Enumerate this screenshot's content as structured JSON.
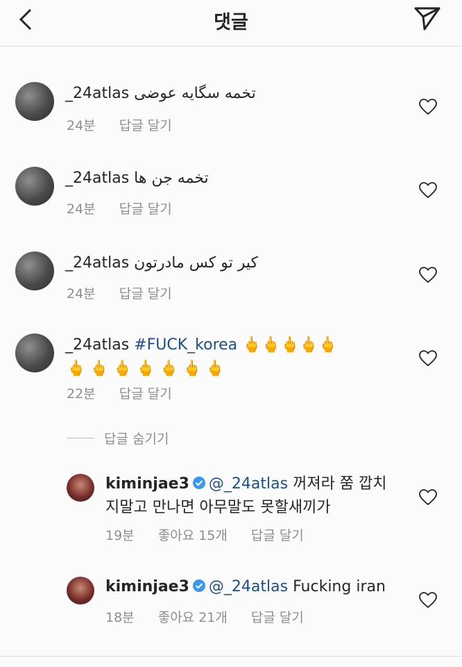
{
  "header": {
    "title": "댓글"
  },
  "comments": [
    {
      "username": "_24atlas",
      "text": "تخمه سگایه عوضی",
      "time": "24분",
      "reply": "답글 달기"
    },
    {
      "username": "_24atlas",
      "text": "تخمه جن ها",
      "time": "24분",
      "reply": "답글 달기"
    },
    {
      "username": "_24atlas",
      "text": "کیر تو کس مادرتون",
      "time": "24분",
      "reply": "답글 달기"
    },
    {
      "username": "_24atlas",
      "hashtag": "#FUCK_korea",
      "emoji_line1": "🖕🖕🖕🖕🖕",
      "emoji_line2": "🖕🖕🖕🖕🖕🖕🖕",
      "time": "22분",
      "reply": "답글 달기"
    }
  ],
  "replies_toggle": "답글 숨기기",
  "replies": [
    {
      "username": "kiminjae3",
      "mention": "@_24atlas",
      "text_line1": "꺼져라 쭘 깝치",
      "text_line2": "지말고 만나면 아무말도 못할새끼가",
      "time": "19분",
      "likes": "좋아요 15개",
      "reply": "답글 달기"
    },
    {
      "username": "kiminjae3",
      "mention": "@_24atlas",
      "text_line1": "Fucking iran",
      "time": "18분",
      "likes": "좋아요 21개",
      "reply": "답글 달기"
    }
  ]
}
